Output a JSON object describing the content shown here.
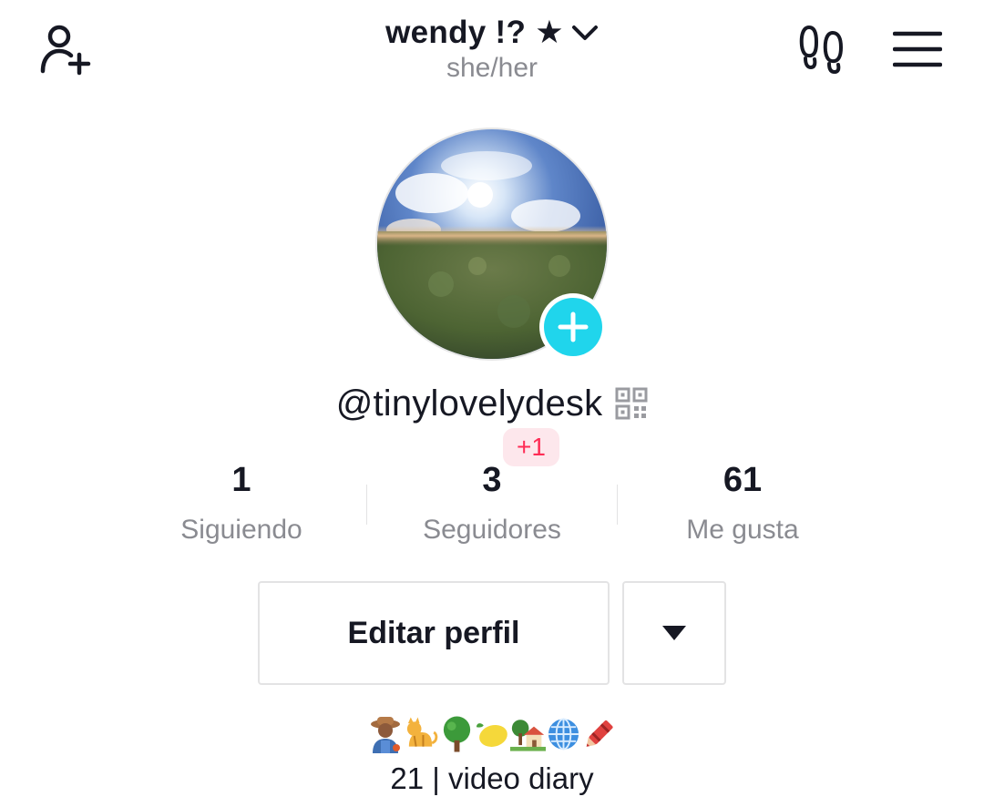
{
  "header": {
    "display_name": "wendy !? ★",
    "pronouns": "she/her",
    "icons": {
      "add_user": "add-user-icon",
      "dropdown": "chevron-down-icon",
      "footprints": "footprints-icon",
      "menu": "hamburger-menu-icon"
    }
  },
  "profile": {
    "username": "@tinylovelydesk",
    "avatar": "sky-sphere-photo",
    "add_photo_icon": "plus-icon",
    "qr_icon": "qr-code-icon"
  },
  "stats": {
    "following": {
      "value": "1",
      "label": "Siguiendo"
    },
    "followers": {
      "value": "3",
      "label": "Seguidores",
      "new_badge": "+1"
    },
    "likes": {
      "value": "61",
      "label": "Me gusta"
    }
  },
  "actions": {
    "edit_profile_label": "Editar perfil",
    "more_icon": "caret-down-icon"
  },
  "bio": {
    "emojis": [
      "farmer",
      "cat",
      "tree",
      "lemon",
      "house-with-garden",
      "globe",
      "crayon"
    ],
    "text": "21 | video diary"
  },
  "colors": {
    "accent_cyan": "#20d5ec",
    "badge_red": "#fe2c55",
    "text_primary": "#161823",
    "text_secondary": "#8a8b91"
  }
}
